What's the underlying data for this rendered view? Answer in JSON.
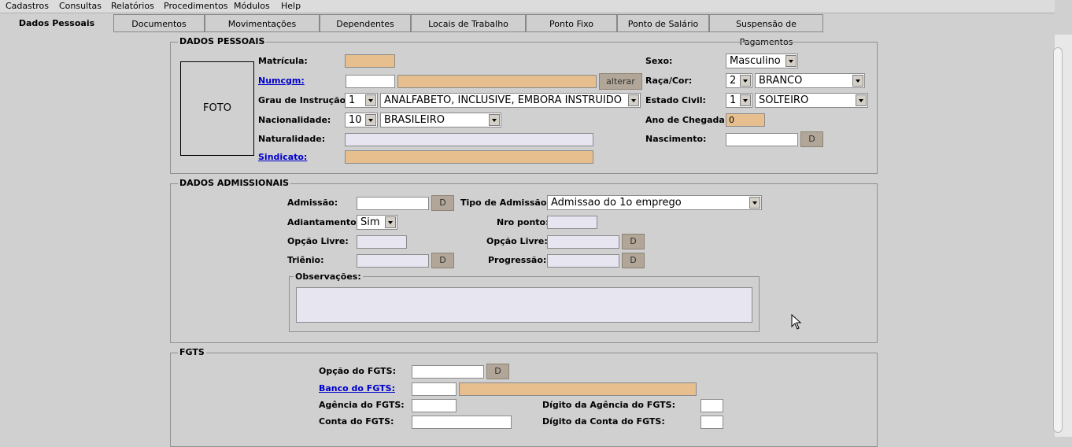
{
  "menu": [
    "Cadastros",
    "Consultas",
    "Relatórios",
    "Procedimentos",
    "Módulos",
    "Help"
  ],
  "tabs": [
    "Dados Pessoais",
    "Documentos",
    "Movimentações",
    "Dependentes",
    "Locais de Trabalho",
    "Ponto Fixo",
    "Ponto de Salário",
    "Suspensão de Pagamentos"
  ],
  "pessoais": {
    "legend": "DADOS PESSOAIS",
    "foto": "FOTO",
    "matricula_label": "Matrícula:",
    "numcgm_label": "Numcgm:",
    "alterar": "alterar",
    "grau_label": "Grau de Instrução:",
    "grau_code": "1",
    "grau_value": "ANALFABETO, INCLUSIVE, EMBORA INSTRUIDO",
    "nacionalidade_label": "Nacionalidade:",
    "nac_code": "10",
    "nac_value": "BRASILEIRO",
    "naturalidade_label": "Naturalidade:",
    "sindicato_label": "Sindicato:",
    "sexo_label": "Sexo:",
    "sexo_value": "Masculino",
    "raca_label": "Raça/Cor:",
    "raca_code": "2",
    "raca_value": "BRANCO",
    "civil_label": "Estado Civil:",
    "civil_code": "1",
    "civil_value": "SOLTEIRO",
    "chegada_label": "Ano de Chegada:",
    "chegada_value": "0",
    "nascimento_label": "Nascimento:",
    "d": "D"
  },
  "admissionais": {
    "legend": "DADOS ADMISSIONAIS",
    "admissao_label": "Admissão:",
    "tipo_label": "Tipo de Admissão:",
    "tipo_value": "Admissao do 1o emprego",
    "adiantamento_label": "Adiantamento:",
    "adiantamento_value": "Sim",
    "nro_ponto_label": "Nro ponto:",
    "opcao_livre_label": "Opção Livre:",
    "trienio_label": "Triênio:",
    "progressao_label": "Progressão:",
    "observacoes_label": "Observações:",
    "d": "D"
  },
  "fgts": {
    "legend": "FGTS",
    "opcao_label": "Opção do FGTS:",
    "banco_label": "Banco do FGTS:",
    "agencia_label": "Agência do FGTS:",
    "digito_agencia_label": "Dígito da Agência do FGTS:",
    "conta_label": "Conta do FGTS:",
    "digito_conta_label": "Dígito da Conta do FGTS:",
    "d": "D"
  }
}
